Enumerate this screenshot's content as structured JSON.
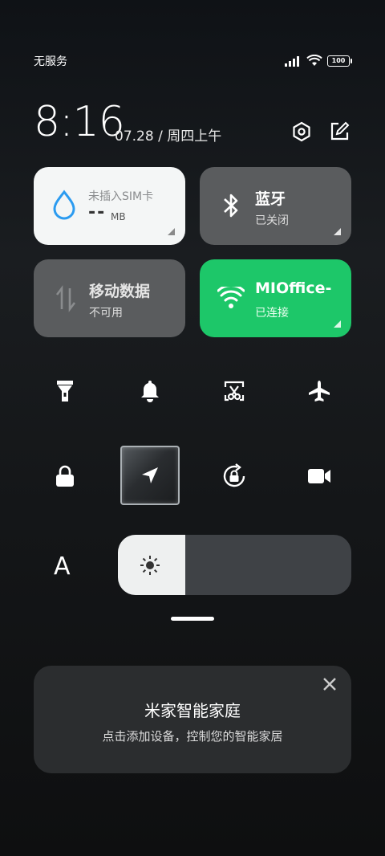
{
  "status_bar": {
    "carrier": "无服务",
    "battery": "100",
    "icons": [
      "signal-icon",
      "wifi-icon",
      "battery-icon"
    ]
  },
  "header": {
    "time": "8:16",
    "date": "07.28 / 周四上午",
    "icons": [
      "settings-icon",
      "edit-icon"
    ]
  },
  "tiles": {
    "data_usage": {
      "label": "未插入SIM卡",
      "value": "--",
      "unit": "MB"
    },
    "bluetooth": {
      "title": "蓝牙",
      "status": "已关闭"
    },
    "mobile_data": {
      "title": "移动数据",
      "status": "不可用"
    },
    "wifi": {
      "title": "MIOffice-",
      "status": "已连接"
    }
  },
  "quick_toggles": [
    {
      "name": "flashlight",
      "active": false
    },
    {
      "name": "mute",
      "active": false
    },
    {
      "name": "screenshot",
      "active": false
    },
    {
      "name": "airplane-mode",
      "active": false
    },
    {
      "name": "lock-screen",
      "active": false
    },
    {
      "name": "location",
      "active": true
    },
    {
      "name": "rotation-lock",
      "active": false
    },
    {
      "name": "screen-recorder",
      "active": false
    }
  ],
  "auto_brightness_label": "A",
  "brightness": {
    "level": 0.29
  },
  "smart_home": {
    "title": "米家智能家庭",
    "subtitle": "点击添加设备，控制您的智能家居"
  },
  "colors": {
    "wifi_active": "#1dc769",
    "tile_inactive": "#5a5c5e",
    "tile_light": "#f4f6f6",
    "data_drop": "#2b9bf0"
  }
}
